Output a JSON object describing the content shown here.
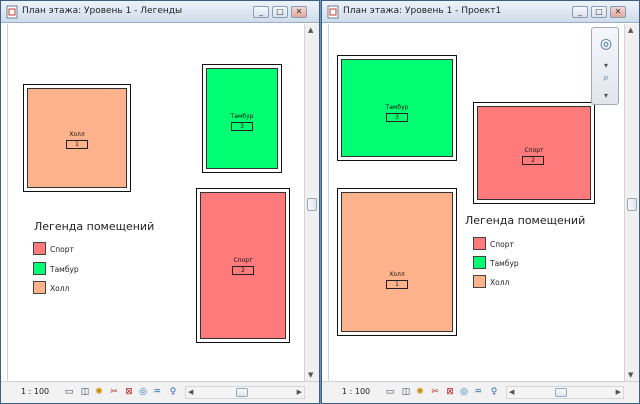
{
  "left_window": {
    "title": "План этажа: Уровень 1 - Легенды",
    "scale": "1 : 100",
    "rooms": [
      {
        "name": "Холл",
        "number": "1",
        "color": "#ffb38c"
      },
      {
        "name": "Тамбур",
        "number": "3",
        "color": "#00ff73"
      },
      {
        "name": "Спорт",
        "number": "2",
        "color": "#ff7b7b"
      }
    ],
    "legend": {
      "title": "Легенда помещений",
      "items": [
        {
          "label": "Спорт",
          "color": "#ff7b7b"
        },
        {
          "label": "Тамбур",
          "color": "#00ff73"
        },
        {
          "label": "Холл",
          "color": "#ffb38c"
        }
      ]
    }
  },
  "right_window": {
    "title": "План этажа: Уровень 1 - Проект1",
    "scale": "1 : 100",
    "rooms": [
      {
        "name": "Тамбур",
        "number": "3",
        "color": "#00ff73"
      },
      {
        "name": "Спорт",
        "number": "2",
        "color": "#ff7b7b"
      },
      {
        "name": "Холл",
        "number": "1",
        "color": "#ffb38c"
      }
    ],
    "legend": {
      "title": "Легенда помещений",
      "items": [
        {
          "label": "Спорт",
          "color": "#ff7b7b"
        },
        {
          "label": "Тамбур",
          "color": "#00ff73"
        },
        {
          "label": "Холл",
          "color": "#ffb38c"
        }
      ]
    }
  },
  "window_buttons": {
    "minimize": "_",
    "restore": "□",
    "close": "✕"
  },
  "icons": [
    "view-cube-icon",
    "sun-path-icon",
    "crop-icon",
    "hide-icon",
    "reveal-icon",
    "temporary-hide-icon",
    "analysis-icon"
  ]
}
